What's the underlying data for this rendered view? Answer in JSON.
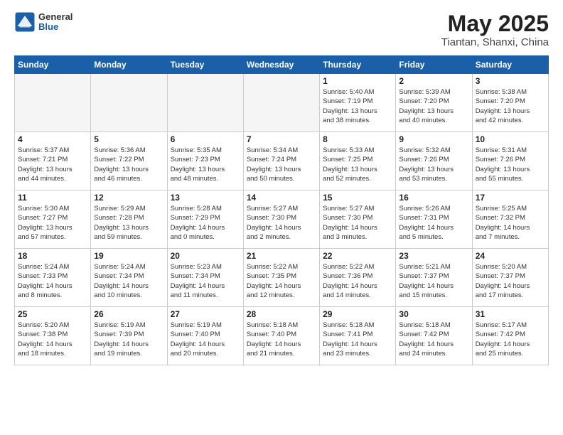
{
  "header": {
    "logo_general": "General",
    "logo_blue": "Blue",
    "month": "May 2025",
    "location": "Tiantan, Shanxi, China"
  },
  "weekdays": [
    "Sunday",
    "Monday",
    "Tuesday",
    "Wednesday",
    "Thursday",
    "Friday",
    "Saturday"
  ],
  "weeks": [
    [
      {
        "day": "",
        "info": ""
      },
      {
        "day": "",
        "info": ""
      },
      {
        "day": "",
        "info": ""
      },
      {
        "day": "",
        "info": ""
      },
      {
        "day": "1",
        "info": "Sunrise: 5:40 AM\nSunset: 7:19 PM\nDaylight: 13 hours\nand 38 minutes."
      },
      {
        "day": "2",
        "info": "Sunrise: 5:39 AM\nSunset: 7:20 PM\nDaylight: 13 hours\nand 40 minutes."
      },
      {
        "day": "3",
        "info": "Sunrise: 5:38 AM\nSunset: 7:20 PM\nDaylight: 13 hours\nand 42 minutes."
      }
    ],
    [
      {
        "day": "4",
        "info": "Sunrise: 5:37 AM\nSunset: 7:21 PM\nDaylight: 13 hours\nand 44 minutes."
      },
      {
        "day": "5",
        "info": "Sunrise: 5:36 AM\nSunset: 7:22 PM\nDaylight: 13 hours\nand 46 minutes."
      },
      {
        "day": "6",
        "info": "Sunrise: 5:35 AM\nSunset: 7:23 PM\nDaylight: 13 hours\nand 48 minutes."
      },
      {
        "day": "7",
        "info": "Sunrise: 5:34 AM\nSunset: 7:24 PM\nDaylight: 13 hours\nand 50 minutes."
      },
      {
        "day": "8",
        "info": "Sunrise: 5:33 AM\nSunset: 7:25 PM\nDaylight: 13 hours\nand 52 minutes."
      },
      {
        "day": "9",
        "info": "Sunrise: 5:32 AM\nSunset: 7:26 PM\nDaylight: 13 hours\nand 53 minutes."
      },
      {
        "day": "10",
        "info": "Sunrise: 5:31 AM\nSunset: 7:26 PM\nDaylight: 13 hours\nand 55 minutes."
      }
    ],
    [
      {
        "day": "11",
        "info": "Sunrise: 5:30 AM\nSunset: 7:27 PM\nDaylight: 13 hours\nand 57 minutes."
      },
      {
        "day": "12",
        "info": "Sunrise: 5:29 AM\nSunset: 7:28 PM\nDaylight: 13 hours\nand 59 minutes."
      },
      {
        "day": "13",
        "info": "Sunrise: 5:28 AM\nSunset: 7:29 PM\nDaylight: 14 hours\nand 0 minutes."
      },
      {
        "day": "14",
        "info": "Sunrise: 5:27 AM\nSunset: 7:30 PM\nDaylight: 14 hours\nand 2 minutes."
      },
      {
        "day": "15",
        "info": "Sunrise: 5:27 AM\nSunset: 7:30 PM\nDaylight: 14 hours\nand 3 minutes."
      },
      {
        "day": "16",
        "info": "Sunrise: 5:26 AM\nSunset: 7:31 PM\nDaylight: 14 hours\nand 5 minutes."
      },
      {
        "day": "17",
        "info": "Sunrise: 5:25 AM\nSunset: 7:32 PM\nDaylight: 14 hours\nand 7 minutes."
      }
    ],
    [
      {
        "day": "18",
        "info": "Sunrise: 5:24 AM\nSunset: 7:33 PM\nDaylight: 14 hours\nand 8 minutes."
      },
      {
        "day": "19",
        "info": "Sunrise: 5:24 AM\nSunset: 7:34 PM\nDaylight: 14 hours\nand 10 minutes."
      },
      {
        "day": "20",
        "info": "Sunrise: 5:23 AM\nSunset: 7:34 PM\nDaylight: 14 hours\nand 11 minutes."
      },
      {
        "day": "21",
        "info": "Sunrise: 5:22 AM\nSunset: 7:35 PM\nDaylight: 14 hours\nand 12 minutes."
      },
      {
        "day": "22",
        "info": "Sunrise: 5:22 AM\nSunset: 7:36 PM\nDaylight: 14 hours\nand 14 minutes."
      },
      {
        "day": "23",
        "info": "Sunrise: 5:21 AM\nSunset: 7:37 PM\nDaylight: 14 hours\nand 15 minutes."
      },
      {
        "day": "24",
        "info": "Sunrise: 5:20 AM\nSunset: 7:37 PM\nDaylight: 14 hours\nand 17 minutes."
      }
    ],
    [
      {
        "day": "25",
        "info": "Sunrise: 5:20 AM\nSunset: 7:38 PM\nDaylight: 14 hours\nand 18 minutes."
      },
      {
        "day": "26",
        "info": "Sunrise: 5:19 AM\nSunset: 7:39 PM\nDaylight: 14 hours\nand 19 minutes."
      },
      {
        "day": "27",
        "info": "Sunrise: 5:19 AM\nSunset: 7:40 PM\nDaylight: 14 hours\nand 20 minutes."
      },
      {
        "day": "28",
        "info": "Sunrise: 5:18 AM\nSunset: 7:40 PM\nDaylight: 14 hours\nand 21 minutes."
      },
      {
        "day": "29",
        "info": "Sunrise: 5:18 AM\nSunset: 7:41 PM\nDaylight: 14 hours\nand 23 minutes."
      },
      {
        "day": "30",
        "info": "Sunrise: 5:18 AM\nSunset: 7:42 PM\nDaylight: 14 hours\nand 24 minutes."
      },
      {
        "day": "31",
        "info": "Sunrise: 5:17 AM\nSunset: 7:42 PM\nDaylight: 14 hours\nand 25 minutes."
      }
    ]
  ]
}
